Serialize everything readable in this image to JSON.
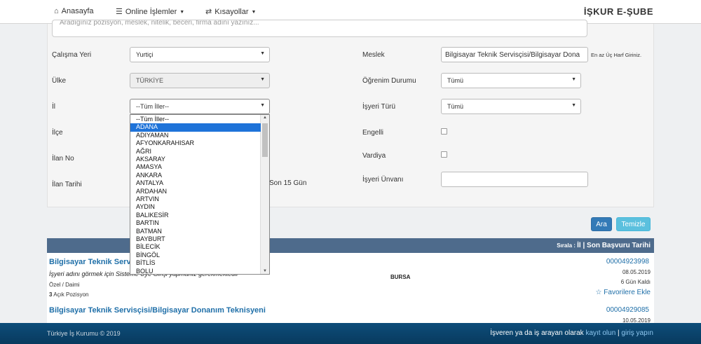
{
  "nav": {
    "home": "Anasayfa",
    "online": "Online İşlemler",
    "shortcuts": "Kısayollar",
    "brand": "İŞKUR E-ŞUBE"
  },
  "search": {
    "placeholder": "Aradığınız pozisyon, meslek, nitelik, beceri, firma adını yazınız..."
  },
  "filters": {
    "calisma_yeri_label": "Çalışma Yeri",
    "calisma_yeri_value": "Yurtiçi",
    "ulke_label": "Ülke",
    "ulke_value": "TÜRKİYE",
    "il_label": "İl",
    "il_value": "--Tüm İller--",
    "ilce_label": "İlçe",
    "ilan_no_label": "İlan No",
    "ilan_tarihi_label": "İlan Tarihi",
    "ilan_tarihi_partial": "Son 15 Gün",
    "meslek_label": "Meslek",
    "meslek_value": "Bilgisayar Teknik Servisçisi/Bilgisayar Dona",
    "meslek_hint": "En az Üç Harf Giriniz.",
    "ogrenim_label": "Öğrenim Durumu",
    "ogrenim_value": "Tümü",
    "isyeri_turu_label": "İşyeri Türü",
    "isyeri_turu_value": "Tümü",
    "engelli_label": "Engelli",
    "vardiya_label": "Vardiya",
    "isyeri_unvani_label": "İşyeri Ünvanı"
  },
  "dropdown_options": [
    "--Tüm İller--",
    "ADANA",
    "ADIYAMAN",
    "AFYONKARAHISAR",
    "AĞRI",
    "AKSARAY",
    "AMASYA",
    "ANKARA",
    "ANTALYA",
    "ARDAHAN",
    "ARTVIN",
    "AYDIN",
    "BALIKESİR",
    "BARTIN",
    "BATMAN",
    "BAYBURT",
    "BİLECİK",
    "BİNGÖL",
    "BİTLİS",
    "BOLU"
  ],
  "dropdown_selected_index": 1,
  "buttons": {
    "ara": "Ara",
    "temizle": "Temizle"
  },
  "results": {
    "sort_prefix": "Sırala : ",
    "sort_il": "İl",
    "sort_sep": " | ",
    "sort_date": "Son Başvuru Tarihi",
    "jobs": [
      {
        "title": "Bilgisayar Teknik Servisçisi/Bilgisayar Donanım Teknisyeni",
        "note": "İşyeri adını görmek için Sisteme Üye Girişi yapmanız gerekmektedir",
        "type": "Özel / Daimi",
        "count": "3",
        "count_label": " Açık Pozisyon",
        "city": "BURSA",
        "number": "00004923998",
        "date": "08.05.2019",
        "remaining": "6 Gün Kaldı",
        "favorite": "Favorilere Ekle"
      },
      {
        "title": "Bilgisayar Teknik Servisçisi/Bilgisayar Donanım Teknisyeni",
        "number": "00004929085",
        "date": "10.05.2019"
      }
    ]
  },
  "footer": {
    "copyright": "Türkiye İş Kurumu © 2019",
    "text1": "İşveren ya da iş arayan olarak ",
    "kayit": "kayıt olun",
    "sep": " | ",
    "giris": "giriş yapın"
  },
  "colors": {
    "primary_button": "#337ab7",
    "info_button": "#5bc0de",
    "results_header": "#4e6b8c",
    "footer": "#0d4d7a",
    "link": "#1f6fa8",
    "dropdown_selected": "#1e73d9"
  }
}
